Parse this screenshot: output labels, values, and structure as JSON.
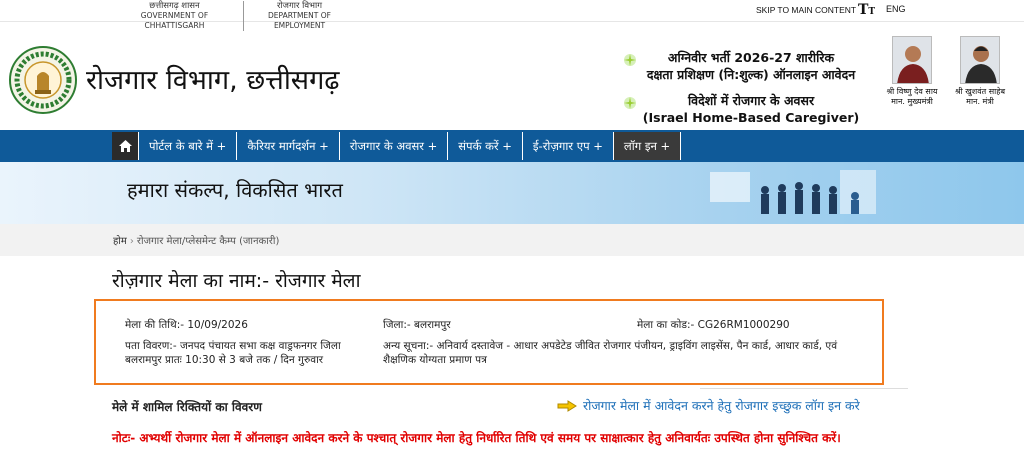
{
  "topbar": {
    "gov_hi": "छत्तीसगढ़ शासन",
    "gov_en": "GOVERNMENT OF CHHATTISGARH",
    "dept_hi": "रोजगार विभाग",
    "dept_en": "DEPARTMENT OF EMPLOYMENT",
    "skip_label": "SKIP TO MAIN CONTENT",
    "text_size_label": "T",
    "text_size_small": "T",
    "lang_label": "ENG"
  },
  "header": {
    "title": "रोजगार विभाग, छत्तीसगढ़",
    "logo_icon": "chhattisgarh-emblem-icon",
    "promo1_line1": "अग्निवीर भर्ती 2026-27 शारीरिक",
    "promo1_line2": "दक्षता प्रशिक्षण (नि:शुल्क) ऑनलाइन आवेदन",
    "promo2_line1": "विदेशों में रोजगार के अवसर",
    "promo2_line2": "(Israel Home-Based Caregiver)",
    "leaders": [
      {
        "name": "श्री विष्णु देव साय",
        "role": "मान. मुख्यमंत्री"
      },
      {
        "name": "श्री खुशवंत साहेब",
        "role": "मान. मंत्री"
      }
    ]
  },
  "nav": {
    "home_icon": "home-icon",
    "items": [
      "पोर्टल के बारे में +",
      "कैरियर मार्गदर्शन +",
      "रोजगार के अवसर +",
      "संपर्क करें +",
      "ई-रोज़गार एप +",
      "लॉग इन +"
    ]
  },
  "banner": {
    "title": "हमारा संकल्प, विकसित भारत"
  },
  "breadcrumb": {
    "home": "होम",
    "separator": "›",
    "current": "रोजगार मेला/प्लेसमेन्ट कैम्प (जानकारी)"
  },
  "page": {
    "title": "रोज़गार मेला का नाम:- रोजगार मेला",
    "date": "मेला की तिथि:- 10/09/2026",
    "district": "जिला:- बलरामपुर",
    "code": "मेला का कोड:- CG26RM1000290",
    "address": "पता विवरण:- जनपद पंचायत सभा कक्ष वाड्रफनगर जिला बलरामपुर प्रातः 10:30 से 3 बजे तक / दिन गुरुवार",
    "other_info": "अन्य सूचना:- अनिवार्य दस्तावेज - आधार अपडेटेड जीवित रोजगार पंजीयन, ड्राइविंग लाइसेंस, पैन कार्ड, आधार कार्ड, एवं शैक्षणिक योग्यता प्रमाण पत्र",
    "vacancy_heading": "मेले में शामिल रिक्तियों का विवरण",
    "apply_link": "रोजगार मेला में आवेदन करने हेतु रोजगार इच्छुक लॉग इन करे",
    "apply_icon": "pointing-hand-icon",
    "note": "नोटः- अभ्यर्थी रोजगार मेला में ऑनलाइन आवेदन करने के पश्चात् रोजगार मेला हेतु निर्धारित तिथि एवं समय पर साक्षात्कार हेतु अनिवार्यतः उपस्थित होना सुनिश्चित करें।"
  },
  "colors": {
    "nav_bg": "#0f5a99",
    "details_border": "#f07b1f",
    "note_text": "#e10000",
    "link_text": "#1d6fb8"
  }
}
